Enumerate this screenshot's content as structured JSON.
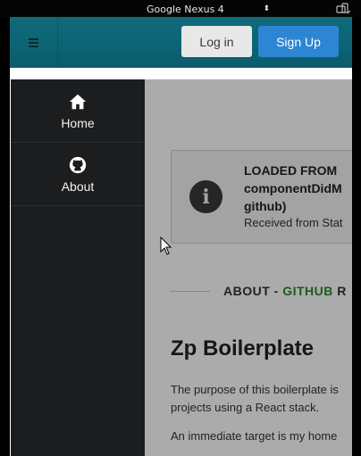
{
  "device_bar": {
    "device_name": "Google Nexus 4",
    "updown_glyph": "⬍"
  },
  "navbar": {
    "login_label": "Log in",
    "signup_label": "Sign Up"
  },
  "drawer": {
    "items": [
      {
        "label": "Home",
        "icon": "home-icon"
      },
      {
        "label": "About",
        "icon": "github-icon"
      }
    ]
  },
  "main": {
    "alert": {
      "title": "LOADED FROM\ncomponentDidM\ngithub)",
      "subtitle": "Received from Stat",
      "icon_glyph": "i"
    },
    "section": {
      "prefix": "ABOUT - ",
      "github": "GITHUB",
      "suffix": " R"
    },
    "heading": "Zp Boilerplate",
    "paragraph1": "The purpose of this boilerplate is\nprojects using a React stack.",
    "paragraph2": "An immediate target is my home"
  },
  "colors": {
    "navbar": "#0c6373",
    "login_button": "#e8e8e8",
    "signup_button": "#2d86d4",
    "drawer": "#1c1d1f",
    "github_accent": "#2a8a2a"
  }
}
